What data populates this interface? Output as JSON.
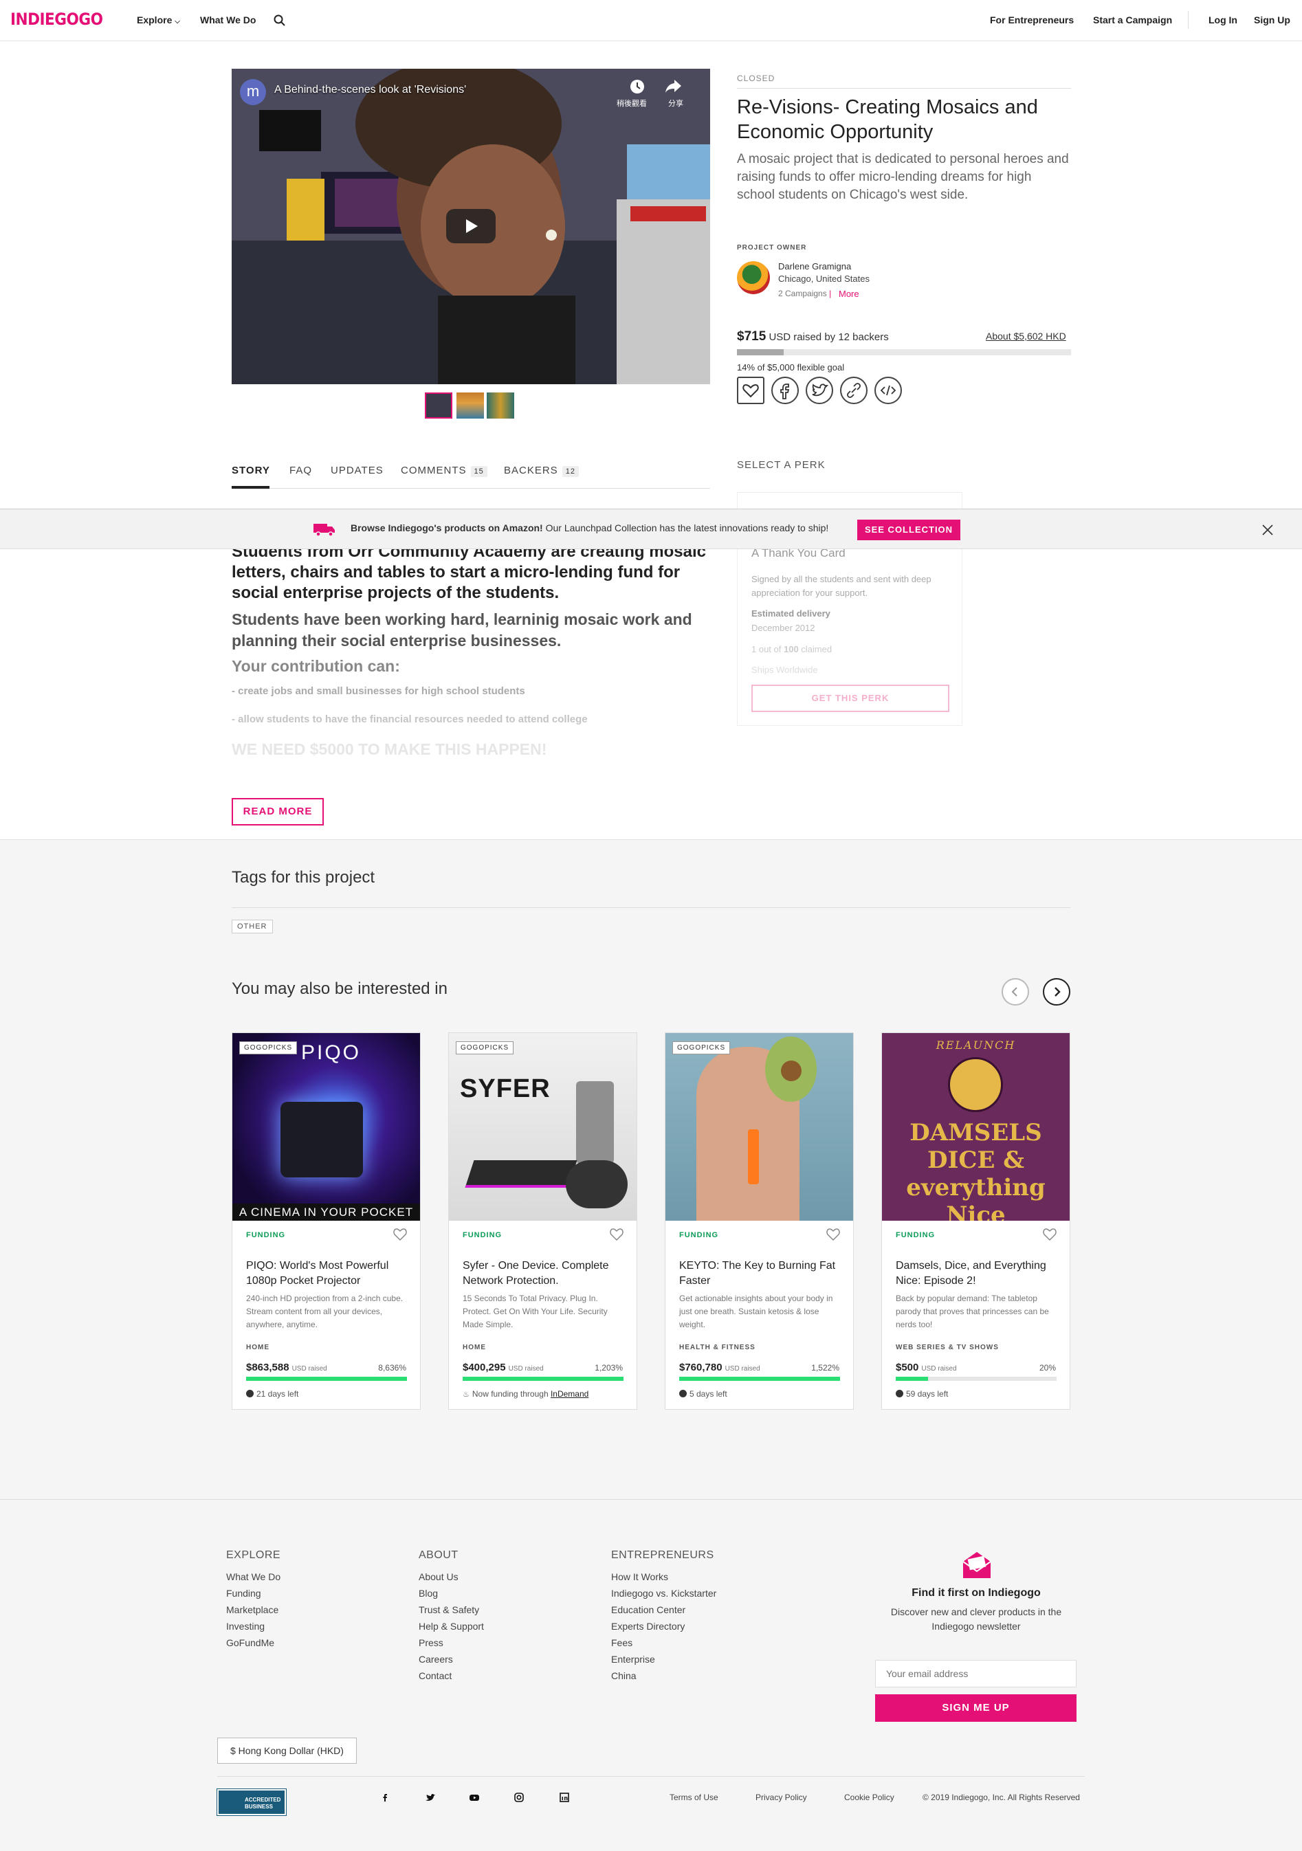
{
  "header": {
    "logo": "INDIEGOGO",
    "nav_left": [
      "Explore",
      "What We Do"
    ],
    "nav_right": [
      "For Entrepreneurs",
      "Start a Campaign",
      "Log In",
      "Sign Up"
    ]
  },
  "video": {
    "channel_initial": "m",
    "title": "A Behind-the-scenes look at 'Revisions'",
    "watch_later": "稍後觀看",
    "share": "分享"
  },
  "project": {
    "status": "CLOSED",
    "title": "Re-Visions- Creating Mosaics and Economic Opportunity",
    "blurb": "A mosaic project that is dedicated to personal heroes and raising funds to offer micro-lending dreams for high school students on Chicago's west side.",
    "owner_label": "PROJECT OWNER",
    "owner_name": "Darlene Gramigna",
    "owner_location": "Chicago, United States",
    "owner_campaigns": "2 Campaigns",
    "owner_more": "More",
    "amount": "$715",
    "raised_text": "USD raised by 12 backers",
    "converted": "About $5,602 HKD",
    "percent_funded": 14,
    "goal_text": "14% of $5,000 flexible goal"
  },
  "tabs": {
    "story": "STORY",
    "faq": "FAQ",
    "updates": "UPDATES",
    "comments": "COMMENTS",
    "comments_count": "15",
    "backers": "BACKERS",
    "backers_count": "12"
  },
  "perks": {
    "label": "SELECT A PERK",
    "title": "A Thank You Card",
    "description": "Signed by all the students and sent with deep appreciation for your support.",
    "delivery_label": "Estimated delivery",
    "delivery_value": "December 2012",
    "claimed_prefix": "1 out of ",
    "claimed_total": "100",
    "claimed_suffix": " claimed",
    "ships": "Ships Worldwide",
    "button": "GET THIS PERK"
  },
  "banner": {
    "bold": "Browse Indiegogo's products on Amazon!",
    "text": " Our Launchpad Collection has the latest innovations ready to ship!",
    "button": "SEE COLLECTION"
  },
  "story": {
    "p1": "Students from Orr Community Academy are creating mosaic letters, chairs and tables to start a micro-lending fund for social enterprise projects of the students.",
    "p2": "Students have been working hard, learninig mosaic work and planning their social enterprise businesses.",
    "p3": "Your contribution can:",
    "p4": "- create jobs and small businesses for high school students",
    "p5": "- allow students to have the financial resources needed to attend college",
    "p6": "WE NEED $5000 TO MAKE THIS HAPPEN!",
    "read_more": "READ MORE"
  },
  "tags": {
    "heading": "Tags for this project",
    "items": [
      "OTHER"
    ]
  },
  "related": {
    "heading": "You may also be interested in",
    "cards": [
      {
        "badge": "GOGOPICKS",
        "image_text": "PIQO",
        "image_caption": "A CINEMA IN YOUR POCKET",
        "status": "FUNDING",
        "title": "PIQO: World's Most Powerful 1080p Pocket Projector",
        "blurb": "240-inch HD projection from a 2-inch cube. Stream content from all your devices, anywhere, anytime.",
        "category": "HOME",
        "amount": "$863,588",
        "usd": "USD raised",
        "percent": "8,636%",
        "bar": 1.0,
        "footer": "21 days left"
      },
      {
        "badge": "GOGOPICKS",
        "image_text": "SYFER",
        "status": "FUNDING",
        "title": "Syfer - One Device. Complete Network Protection.",
        "blurb": "15 Seconds To Total Privacy. Plug In. Protect. Get On With Your Life. Security Made Simple.",
        "category": "HOME",
        "amount": "$400,295",
        "usd": "USD raised",
        "percent": "1,203%",
        "bar": 1.0,
        "footer": "Now funding through ",
        "footer_link": "InDemand"
      },
      {
        "badge": "GOGOPICKS",
        "status": "FUNDING",
        "title": "KEYTO: The Key to Burning Fat Faster",
        "blurb": "Get actionable insights about your body in just one breath. Sustain ketosis & lose weight.",
        "category": "HEALTH & FITNESS",
        "amount": "$760,780",
        "usd": "USD raised",
        "percent": "1,522%",
        "bar": 1.0,
        "footer": "5 days left"
      },
      {
        "image_text_top": "RELAUNCH",
        "image_text": "DAMSELS DICE & everything Nice",
        "status": "FUNDING",
        "title": "Damsels, Dice, and Everything Nice: Episode 2!",
        "blurb": "Back by popular demand: The tabletop parody that proves that princesses can be nerds too!",
        "category": "WEB SERIES & TV SHOWS",
        "amount": "$500",
        "usd": "USD raised",
        "percent": "20%",
        "bar": 0.2,
        "footer": "59 days left"
      }
    ]
  },
  "footer": {
    "explore": {
      "heading": "EXPLORE",
      "links": [
        "What We Do",
        "Funding",
        "Marketplace",
        "Investing",
        "GoFundMe"
      ]
    },
    "about": {
      "heading": "ABOUT",
      "links": [
        "About Us",
        "Blog",
        "Trust & Safety",
        "Help & Support",
        "Press",
        "Careers",
        "Contact"
      ]
    },
    "entrepreneurs": {
      "heading": "ENTREPRENEURS",
      "links": [
        "How It Works",
        "Indiegogo vs. Kickstarter",
        "Education Center",
        "Experts Directory",
        "Fees",
        "Enterprise",
        "China"
      ]
    },
    "newsletter": {
      "heading": "Find it first on Indiegogo",
      "text": "Discover new and clever products in the Indiegogo newsletter",
      "placeholder": "Your email address",
      "button": "SIGN ME UP"
    },
    "currency": "$ Hong Kong Dollar (HKD)",
    "bbb": "ACCREDITED BUSINESS",
    "social": [
      "facebook-icon",
      "twitter-icon",
      "youtube-icon",
      "instagram-icon",
      "linkedin-icon"
    ],
    "legal": [
      "Terms of Use",
      "Privacy Policy",
      "Cookie Policy"
    ],
    "copyright": "© 2019 Indiegogo, Inc. All Rights Reserved"
  },
  "colors": {
    "brand": "#e51075",
    "funding": "#0c9d58",
    "progress": "#2bde73"
  }
}
